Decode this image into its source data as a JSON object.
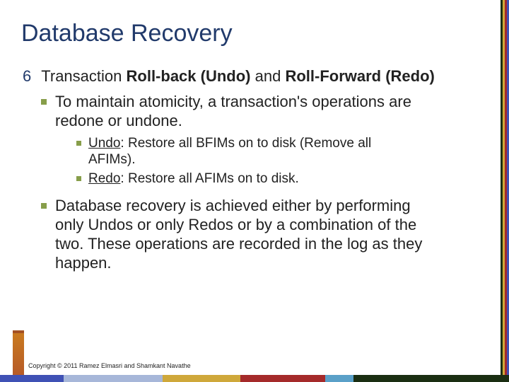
{
  "title": "Database Recovery",
  "section": {
    "number": "6",
    "heading_pre": "Transaction ",
    "heading_b1": "Roll-back (Undo)",
    "heading_mid": " and ",
    "heading_b2": "Roll-Forward ",
    "heading_post": "(Redo)"
  },
  "bullets": {
    "b1": "To maintain atomicity, a transaction's operations are redone or undone.",
    "b1_sub": {
      "s1_label": "Undo",
      "s1_rest": ": Restore all BFIMs on to disk (Remove all AFIMs).",
      "s2_label": "Redo",
      "s2_rest": ": Restore all AFIMs on to disk."
    },
    "b2": "Database recovery is achieved either by performing only Undos or only Redos or by a combination of the two. These operations are recorded in the log as they happen."
  },
  "copyright": "Copyright © 2011 Ramez Elmasri and Shamkant Navathe"
}
